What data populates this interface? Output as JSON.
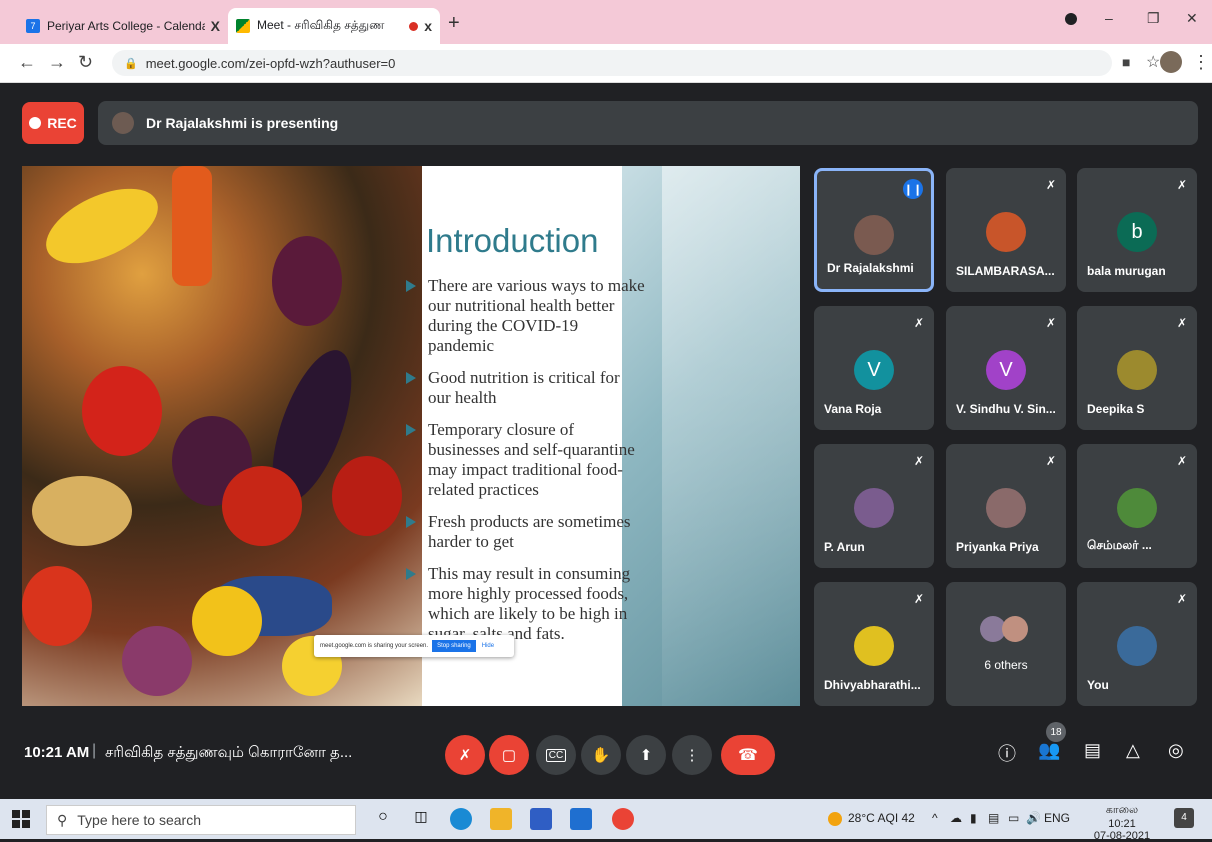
{
  "browser": {
    "tabs": [
      {
        "title": "Periyar Arts College - Calendar - ",
        "favicon_color": "#1a73e8",
        "close": "X"
      },
      {
        "title": "Meet - சரிவிகித சத்துண",
        "favicon_color": "#00832d",
        "close": "x"
      }
    ],
    "new_tab": "+",
    "url": "meet.google.com/zei-opfd-wzh?authuser=0"
  },
  "meet": {
    "rec_label": "REC",
    "presenting_text": "Dr Rajalakshmi is presenting",
    "slide": {
      "title": "Introduction",
      "bullets": [
        "There are various ways to make our nutritional health better during the COVID-19 pandemic",
        "Good nutrition is critical for our health",
        "Temporary closure of businesses and self-quarantine may impact traditional food-related practices",
        "Fresh products are sometimes harder to get",
        "This may result in consuming more highly processed foods, which are likely to be high in sugar, salts and fats."
      ],
      "share_notice": "meet.google.com is sharing your screen.",
      "stop_sharing": "Stop sharing",
      "hide": "Hide"
    },
    "participants": [
      {
        "name": "Dr Rajalakshmi",
        "initial": "",
        "avatar_color": "#7a5a50",
        "active": true
      },
      {
        "name": "SILAMBARASA...",
        "initial": "",
        "avatar_color": "#c8552a"
      },
      {
        "name": "bala murugan",
        "initial": "b",
        "avatar_color": "#0b6b55"
      },
      {
        "name": "Vana Roja",
        "initial": "V",
        "avatar_color": "#12919e"
      },
      {
        "name": "V. Sindhu V. Sin...",
        "initial": "V",
        "avatar_color": "#a142c8"
      },
      {
        "name": "Deepika S",
        "initial": "",
        "avatar_color": "#9c8a2e"
      },
      {
        "name": "P. Arun",
        "initial": "",
        "avatar_color": "#7a5c8e"
      },
      {
        "name": "Priyanka Priya",
        "initial": "",
        "avatar_color": "#8a6a6a"
      },
      {
        "name": "செம்மலர் ...",
        "initial": "",
        "avatar_color": "#4e8a3a"
      },
      {
        "name": "Dhivyabharathi...",
        "initial": "",
        "avatar_color": "#e0c020"
      },
      {
        "name": "",
        "initial": "",
        "avatar_color": "#8a7a9a",
        "others": "6 others"
      },
      {
        "name": "You",
        "initial": "",
        "avatar_color": "#3a6a9a"
      }
    ],
    "time": "10:21 AM",
    "separator": "|",
    "meeting_title": "சரிவிகித சத்துணவும் கொரானோ த...",
    "people_count": "18"
  },
  "taskbar": {
    "search_placeholder": "Type here to search",
    "weather": "28°C  AQI 42",
    "language": "ENG",
    "clock_time": "காலை 10:21",
    "clock_date": "07-08-2021",
    "notifications": "4"
  }
}
